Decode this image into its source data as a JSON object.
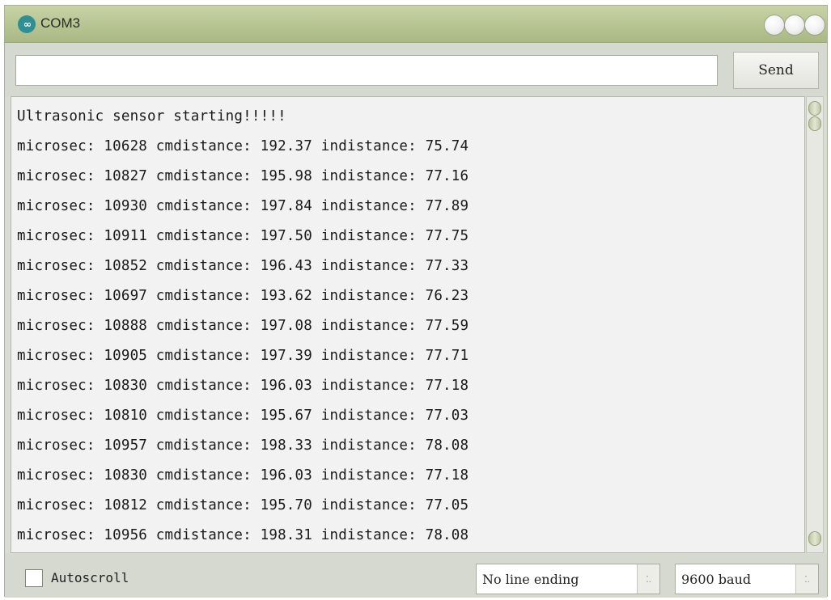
{
  "window": {
    "title": "COM3",
    "icon_glyph": "∞"
  },
  "toolbar": {
    "input_value": "",
    "send_label": "Send"
  },
  "output": {
    "lines": [
      "Ultrasonic sensor starting!!!!!",
      "microsec: 10628 cmdistance: 192.37 indistance: 75.74",
      "microsec: 10827 cmdistance: 195.98 indistance: 77.16",
      "microsec: 10930 cmdistance: 197.84 indistance: 77.89",
      "microsec: 10911 cmdistance: 197.50 indistance: 77.75",
      "microsec: 10852 cmdistance: 196.43 indistance: 77.33",
      "microsec: 10697 cmdistance: 193.62 indistance: 76.23",
      "microsec: 10888 cmdistance: 197.08 indistance: 77.59",
      "microsec: 10905 cmdistance: 197.39 indistance: 77.71",
      "microsec: 10830 cmdistance: 196.03 indistance: 77.18",
      "microsec: 10810 cmdistance: 195.67 indistance: 77.03",
      "microsec: 10957 cmdistance: 198.33 indistance: 78.08",
      "microsec: 10830 cmdistance: 196.03 indistance: 77.18",
      "microsec: 10812 cmdistance: 195.70 indistance: 77.05",
      "microsec: 10956 cmdistance: 198.31 indistance: 78.08"
    ]
  },
  "bottom": {
    "autoscroll_label": "Autoscroll",
    "autoscroll_checked": false,
    "line_ending_value": "No line ending",
    "baud_value": "9600 baud",
    "dropdown_glyph": "⁚."
  },
  "colors": {
    "titlebar": "#b9c796",
    "icon_teal": "#2f8f93",
    "output_background": "#f2f2f2"
  }
}
